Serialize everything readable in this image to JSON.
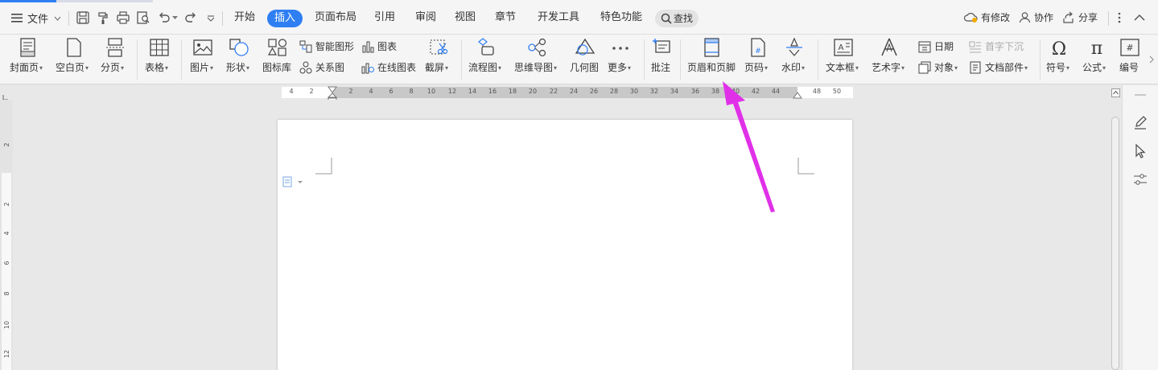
{
  "menubar": {
    "file": "文件",
    "tabs": [
      "开始",
      "插入",
      "页面布局",
      "引用",
      "审阅",
      "视图",
      "章节",
      "开发工具",
      "特色功能"
    ],
    "active_tab": "插入",
    "search": "查找",
    "right": {
      "modified": "有修改",
      "collab": "协作",
      "share": "分享"
    }
  },
  "ribbon": {
    "cover": "封面页",
    "blank": "空白页",
    "break": "分页",
    "table": "表格",
    "picture": "图片",
    "shape": "形状",
    "iconlib": "图标库",
    "smart_shape": "智能图形",
    "chart": "图表",
    "relation": "关系图",
    "online_chart": "在线图表",
    "screenshot": "截屏",
    "flowchart": "流程图",
    "mindmap": "思维导图",
    "geometry": "几何图",
    "more": "更多",
    "comment": "批注",
    "header_footer": "页眉和页脚",
    "page_num": "页码",
    "watermark": "水印",
    "textbox": "文本框",
    "wordart": "艺术字",
    "date": "日期",
    "dropcap": "首字下沉",
    "object": "对象",
    "docpart": "文档部件",
    "symbol": "符号",
    "formula": "公式",
    "numbering": "编号"
  },
  "ruler": {
    "h_ticks": [
      "4",
      "2",
      "2",
      "4",
      "6",
      "8",
      "10",
      "12",
      "14",
      "16",
      "18",
      "20",
      "22",
      "24",
      "26",
      "28",
      "30",
      "32",
      "34",
      "36",
      "38",
      "40",
      "42",
      "44",
      "48",
      "50"
    ],
    "v_ticks": [
      "2",
      "2",
      "4",
      "6",
      "8",
      "10",
      "12"
    ]
  },
  "colors": {
    "accent": "#2f7ff3",
    "arrow": "#e030e8"
  }
}
